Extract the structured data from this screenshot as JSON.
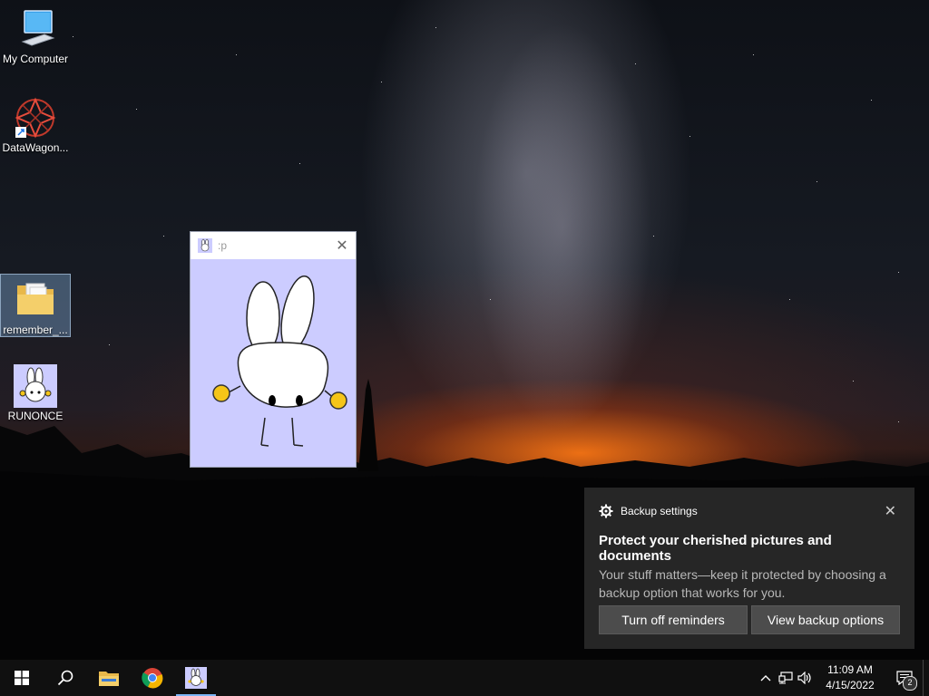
{
  "desktop": {
    "icons": [
      {
        "label": "My Computer"
      },
      {
        "label": "DataWagon..."
      },
      {
        "label": "remember_..."
      },
      {
        "label": "RUNONCE"
      }
    ]
  },
  "mini_window": {
    "title": ":p",
    "close_glyph": "✕"
  },
  "toast": {
    "app_name": "Backup settings",
    "close_glyph": "✕",
    "title": "Protect your cherished pictures and documents",
    "body": "Your stuff matters—keep it protected by choosing a backup option that works for you.",
    "buttons": {
      "turn_off": "Turn off reminders",
      "view_options": "View backup options"
    }
  },
  "taskbar": {
    "clock_time": "11:09 AM",
    "clock_date": "4/15/2022",
    "notification_count": "2",
    "pinned": [
      "start",
      "search",
      "file-explorer",
      "chrome",
      "runonce-app"
    ]
  },
  "colors": {
    "mini_window_bg": "#ccccff",
    "toast_bg": "#282828",
    "taskbar_bg": "#101010",
    "accent": "#7ab4f5"
  }
}
